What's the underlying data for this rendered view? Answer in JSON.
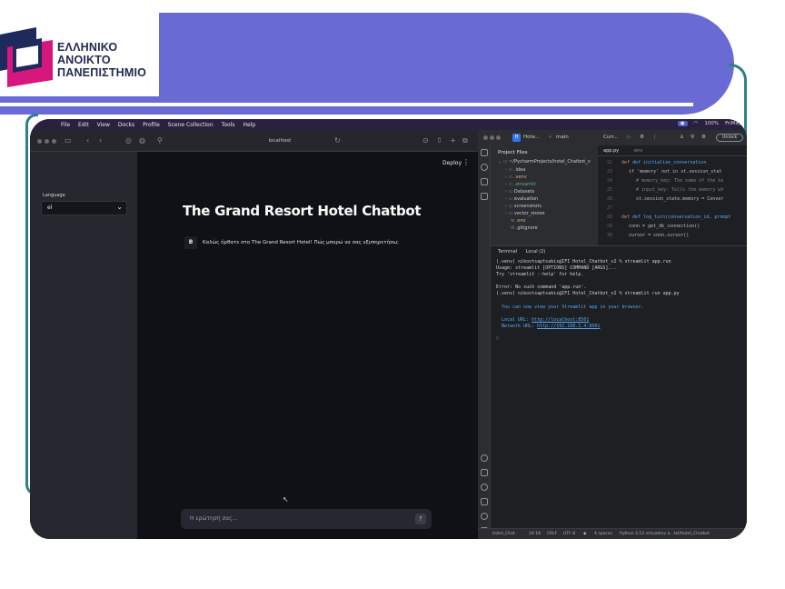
{
  "logo": {
    "line1": "ΕΛΛΗΝΙΚΟ",
    "line2": "ΑΝΟΙΚΤΟ",
    "line3": "ΠΑΝΕΠΙΣΤΗΜΙΟ",
    "colors": {
      "navy": "#1f2a5c",
      "magenta": "#d6177d",
      "band": "#6a6ad4",
      "teal": "#2f7f86"
    }
  },
  "menubar": {
    "items": [
      "File",
      "Edit",
      "View",
      "Docks",
      "Profile",
      "Scene Collection",
      "Tools",
      "Help"
    ],
    "battery": "100%",
    "time": "FriMay"
  },
  "browser": {
    "url": "localhost",
    "deploy_label": "Deploy",
    "sidebar": {
      "language_label": "Language",
      "language_value": "el"
    },
    "app_title": "The Grand Resort Hotel Chatbot",
    "bot_avatar": "B",
    "bot_message": "Καλώς ήρθατε στο The Grand Resort Hotel! Πώς μπορώ να σας εξυπηρετήσω;",
    "input_placeholder": "Η ερώτησή σας..."
  },
  "ide": {
    "project_name": "Hote...",
    "branch": "main",
    "run_config": "Curr...",
    "pill": "Unlock",
    "project_panel_title": "Project Files",
    "tree": [
      "~/PycharmProjects/hotel_Chatbot_v",
      ".idea",
      ".venv",
      ".streamlit",
      "Datasets",
      "evaluation",
      "screenshots",
      "vector_stores",
      ".env",
      ".gitignore"
    ],
    "editor_tab": "app.py",
    "editor_tab2": "env",
    "code_lines": [
      {
        "num": "22",
        "text": "def initialize_conversation"
      },
      {
        "num": "23",
        "text": "if 'memory' not in st.session_stat"
      },
      {
        "num": "24",
        "text": "# memory_key: The name of the ke"
      },
      {
        "num": "25",
        "text": "# input_key: Tells the memory wh"
      },
      {
        "num": "26",
        "text": "st.session_state.memory = Conver"
      },
      {
        "num": "27",
        "text": ""
      },
      {
        "num": "28",
        "text": "def log_turn(conversation_id, prompt"
      },
      {
        "num": "29",
        "text": "conn = get_db_connection()"
      },
      {
        "num": "30",
        "text": "cursor = conn.cursor()"
      }
    ],
    "terminal_tabs": [
      "Terminal",
      "Local (2)"
    ],
    "terminal_lines": [
      "(.venv) nikostsaptsakis@IFI Hotel_Chatbot_v2 % streamlit app.run",
      "Usage: streamlit [OPTIONS] COMMAND [ARGS]...",
      "Try 'streamlit --help' for help.",
      "",
      "Error: No such command 'app.run'.",
      "(.venv) nikostsaptsakis@IFI Hotel_Chatbot_v2 % streamlit run app.py"
    ],
    "terminal_banner": "You can now view your Streamlit app in your browser.",
    "local_url_label": "Local URL:",
    "local_url": "http://localhost:8501",
    "network_url_label": "Network URL:",
    "network_url": "http://192.168.1.4:8501",
    "status": {
      "project": "Hotel_Chat",
      "position": "24:18",
      "line_sep": "CRLF",
      "encoding": "UTF-8",
      "indent": "4 spaces",
      "interpreter": "Python 3.13 virtualenv a...tel/Hotel_Chatbot"
    }
  }
}
